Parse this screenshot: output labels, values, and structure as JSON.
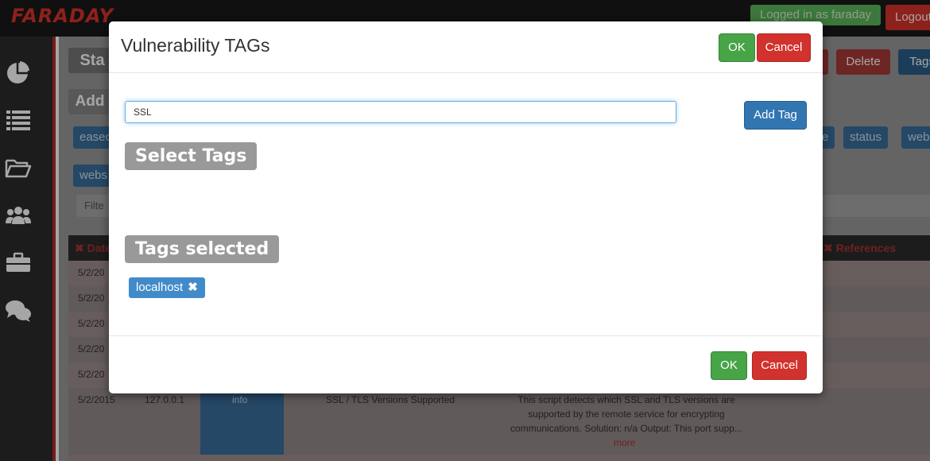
{
  "app": {
    "logo": "FARADAY",
    "login_status": "Logged in as faraday",
    "logout_label": "Logout"
  },
  "background": {
    "title_partial": "Sta",
    "add_partial": "Add",
    "delete_label": "Delete",
    "tags_partial": "Tags",
    "tags_row1": [
      "easec",
      "e",
      "status",
      "web"
    ],
    "tags_row2": [
      "webs"
    ],
    "filter_partial": "Filte",
    "col_date": "✖ Date",
    "col_references": "✖ References",
    "dates": [
      "5/2/20",
      "5/2/20",
      "5/2/20",
      "5/2/20",
      "5/2/20",
      "5/2/2015"
    ],
    "row_host": "127.0.0.1",
    "row_severity": "info",
    "row_name": "SSL / TLS Versions Supported",
    "row_desc_1": "This script detects which SSL and TLS versions are",
    "row_desc_2": "supported by the remote service for encrypting",
    "row_desc_3": "communications. Solution: n/a Output: This port supp...",
    "row_more": "more"
  },
  "modal": {
    "title": "Vulnerability TAGs",
    "ok_label": "OK",
    "cancel_label": "Cancel",
    "input_value": "SSL",
    "add_tag_label": "Add Tag",
    "select_tags_label": "Select Tags",
    "tags_selected_label": "Tags selected",
    "selected_tags": [
      "localhost"
    ],
    "footer_ok_label": "OK",
    "footer_cancel_label": "Cancel"
  },
  "colors": {
    "ok": "#47a447",
    "cancel": "#d2322d",
    "primary": "#3276b1",
    "chip": "#428bca",
    "label": "#999999"
  }
}
